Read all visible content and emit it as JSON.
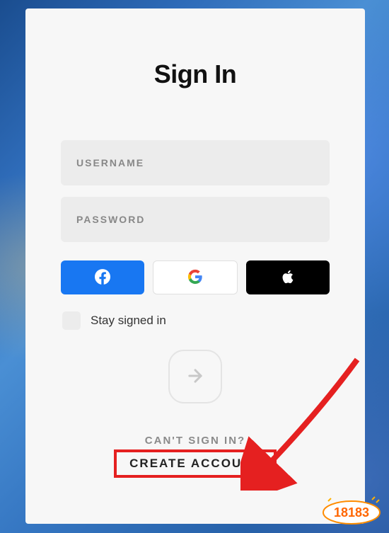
{
  "title": "Sign In",
  "inputs": {
    "username_placeholder": "USERNAME",
    "password_placeholder": "PASSWORD"
  },
  "social": {
    "facebook": "facebook",
    "google": "google",
    "apple": "apple"
  },
  "stay_signed_in_label": "Stay signed in",
  "footer": {
    "cant_sign_in": "CAN'T SIGN IN?",
    "create_account": "CREATE ACCOUNT"
  },
  "colors": {
    "facebook": "#1877f2",
    "apple": "#000000",
    "highlight": "#e52020"
  },
  "watermark": "18183"
}
